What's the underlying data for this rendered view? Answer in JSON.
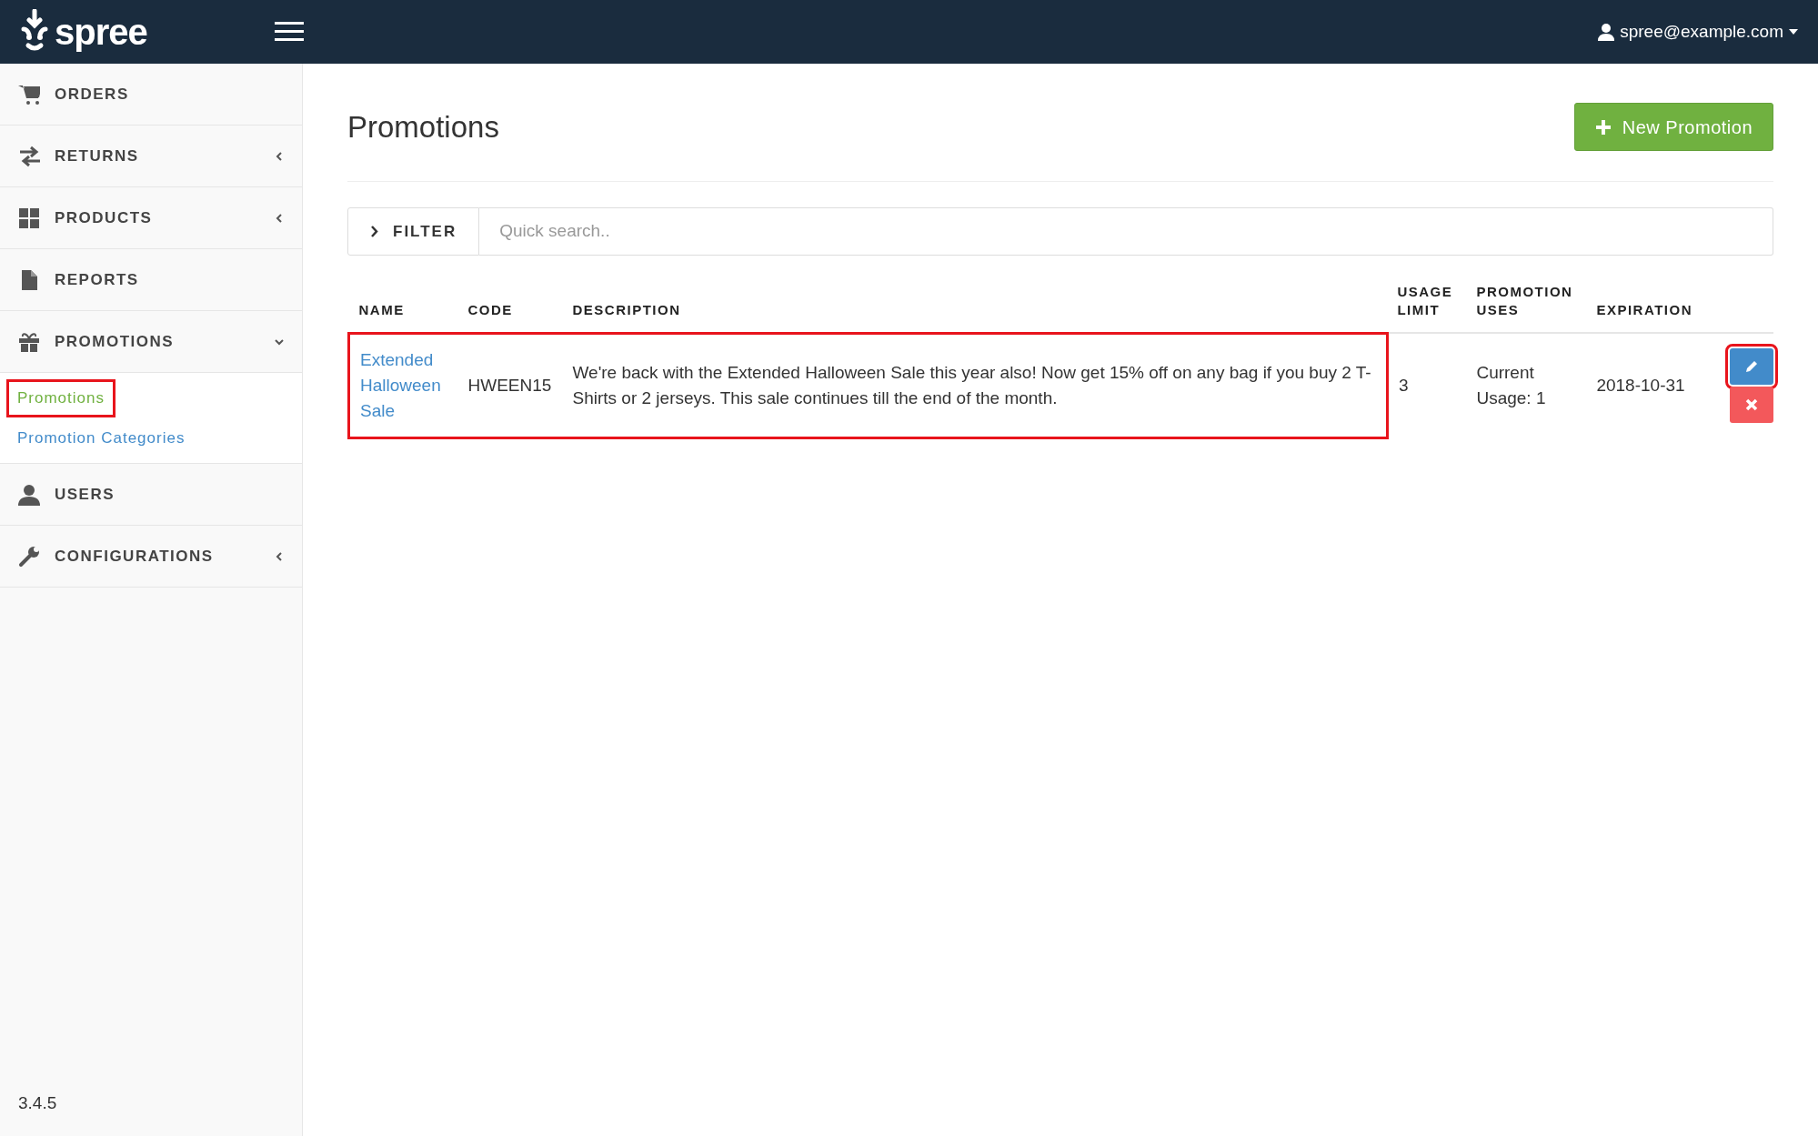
{
  "header": {
    "logo": "spree",
    "user": "spree@example.com"
  },
  "sidebar": {
    "items": [
      {
        "kind": "cart",
        "label": "ORDERS"
      },
      {
        "kind": "arrows",
        "label": "RETURNS",
        "expanded": false
      },
      {
        "kind": "grid",
        "label": "PRODUCTS",
        "expanded": false
      },
      {
        "kind": "file",
        "label": "REPORTS"
      },
      {
        "kind": "gift",
        "label": "PROMOTIONS",
        "expanded": true,
        "children": [
          {
            "label": "Promotions",
            "selected": true,
            "highlighted": true
          },
          {
            "label": "Promotion Categories",
            "selected": false,
            "highlighted": false
          }
        ]
      },
      {
        "kind": "user",
        "label": "USERS"
      },
      {
        "kind": "wrench",
        "label": "CONFIGURATIONS",
        "expanded": false
      }
    ],
    "version": "3.4.5"
  },
  "page": {
    "title": "Promotions",
    "new_button": "New Promotion"
  },
  "filter": {
    "button": "FILTER",
    "placeholder": "Quick search.."
  },
  "table": {
    "columns": [
      "NAME",
      "CODE",
      "DESCRIPTION",
      "USAGE LIMIT",
      "PROMOTION USES",
      "EXPIRATION"
    ],
    "rows": [
      {
        "name": "Extended Halloween Sale",
        "code": "HWEEN15",
        "description": "We're back with the Extended Halloween Sale this year also! Now get 15% off on any bag if you buy 2 T-Shirts or 2 jerseys. This sale continues till the end of the month.",
        "usage_limit": "3",
        "uses": "Current Usage: 1",
        "expiration": "2018-10-31",
        "highlighted": true,
        "edit_highlighted": true
      }
    ]
  }
}
